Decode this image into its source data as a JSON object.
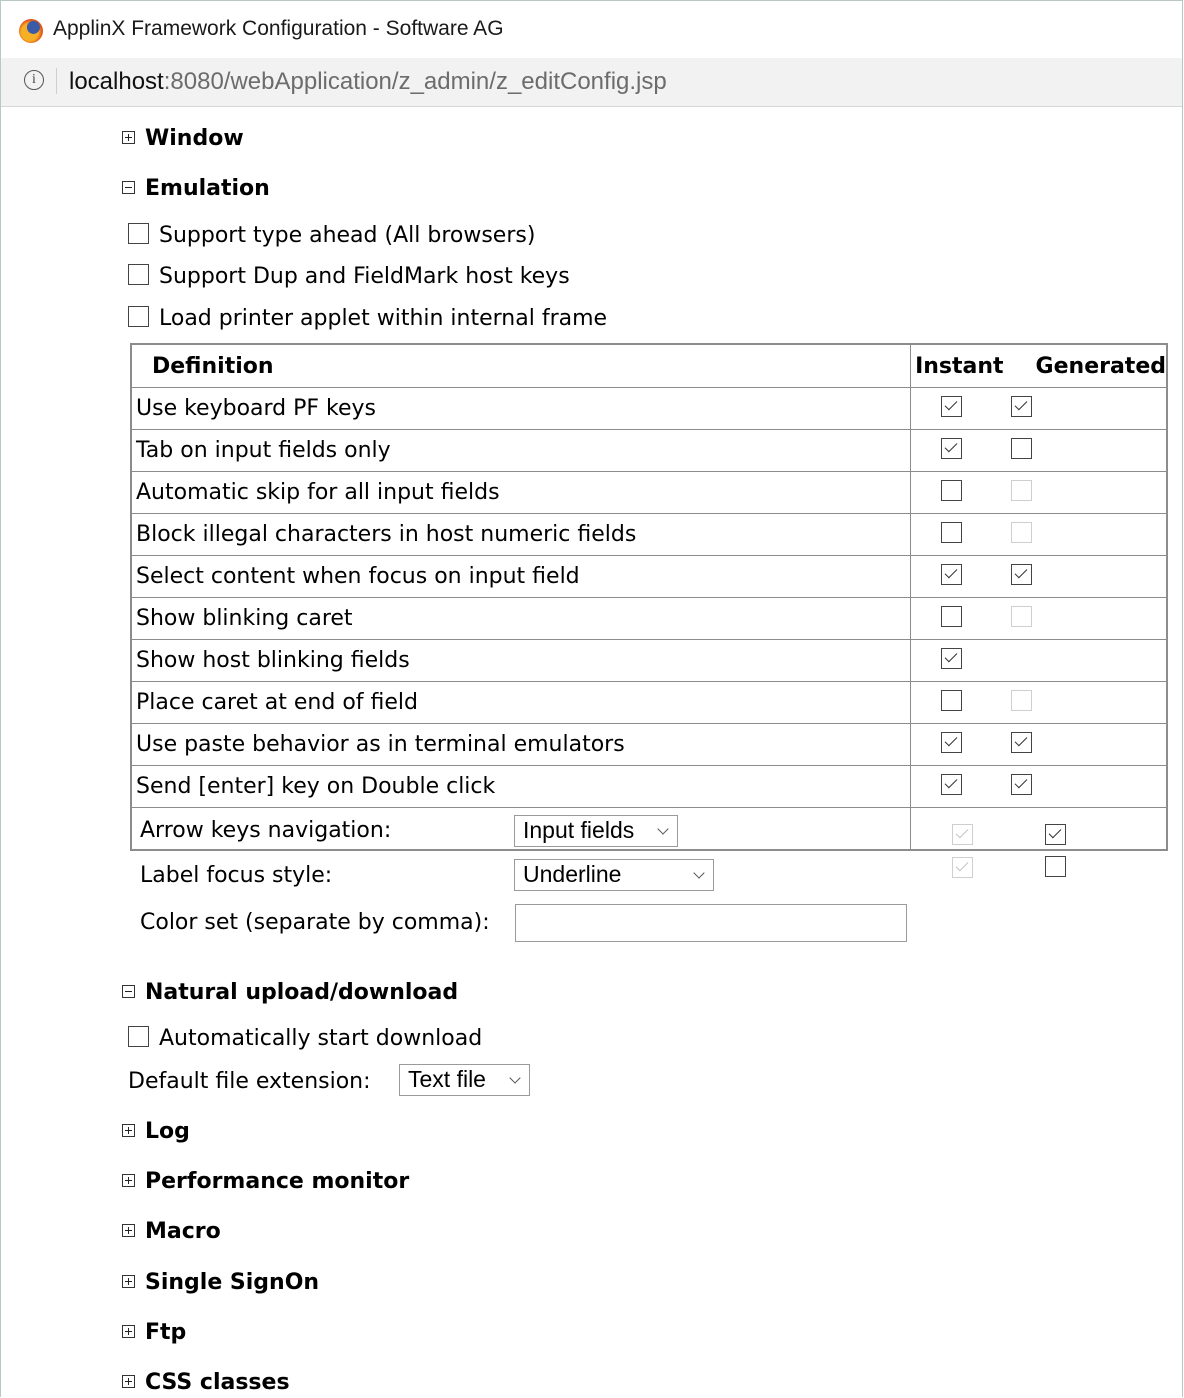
{
  "window": {
    "title": "ApplinX Framework Configuration - Software AG",
    "url_host": "localhost",
    "url_path": ":8080/webApplication/z_admin/z_editConfig.jsp"
  },
  "sections": {
    "window": "Window",
    "emulation": "Emulation",
    "natural": "Natural upload/download",
    "log": "Log",
    "perf": "Performance monitor",
    "macro": "Macro",
    "sso": "Single SignOn",
    "ftp": "Ftp",
    "css": "CSS classes"
  },
  "emulation": {
    "options": [
      {
        "label": "Support type ahead (All browsers)",
        "checked": false
      },
      {
        "label": "Support Dup and FieldMark host keys",
        "checked": false
      },
      {
        "label": "Load printer applet within internal frame",
        "checked": false
      }
    ],
    "table": {
      "header_definition": "Definition",
      "header_instant": "Instant",
      "header_generated": "Generated",
      "rows": [
        {
          "label": "Use keyboard PF keys",
          "instant": "checked",
          "generated": "checked"
        },
        {
          "label": "Tab on input fields only",
          "instant": "checked",
          "generated": "unchecked"
        },
        {
          "label": "Automatic skip for all input fields",
          "instant": "unchecked",
          "generated": "disabled"
        },
        {
          "label": "Block illegal characters in host numeric fields",
          "instant": "unchecked",
          "generated": "disabled"
        },
        {
          "label": "Select content when focus on input field",
          "instant": "checked",
          "generated": "checked"
        },
        {
          "label": "Show blinking caret",
          "instant": "unchecked",
          "generated": "disabled"
        },
        {
          "label": "Show host blinking fields",
          "instant": "checked",
          "generated": "none"
        },
        {
          "label": "Place caret at end of field",
          "instant": "unchecked",
          "generated": "disabled"
        },
        {
          "label": "Use paste behavior as in terminal emulators",
          "instant": "checked",
          "generated": "checked"
        },
        {
          "label": "Send [enter] key on Double click",
          "instant": "checked",
          "generated": "checked"
        }
      ],
      "arrow_keys_label": "Arrow keys navigation:",
      "arrow_keys_value": "Input fields",
      "label_focus_label": "Label focus style:",
      "label_focus_value": "Underline",
      "color_set_label": "Color set (separate by comma):",
      "color_set_value": ""
    }
  },
  "natural": {
    "auto_download_label": "Automatically start download",
    "auto_download_checked": false,
    "default_ext_label": "Default file extension:",
    "default_ext_value": "Text file"
  }
}
